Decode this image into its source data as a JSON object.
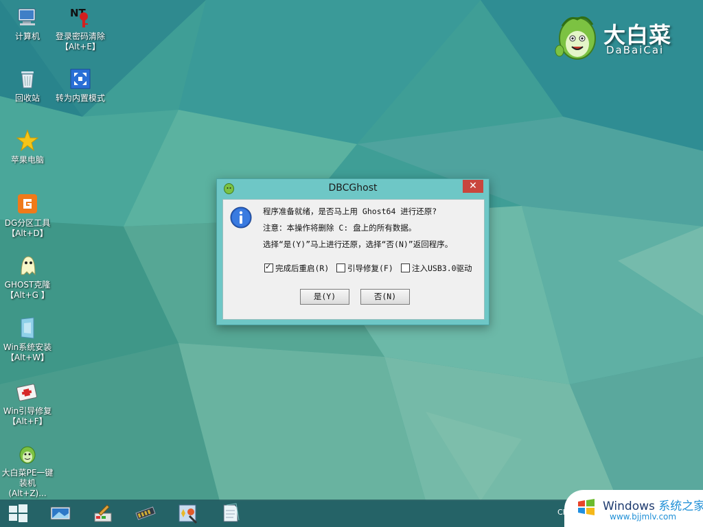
{
  "desktop": {
    "icons": [
      {
        "name": "computer",
        "label": "计算机",
        "icon": "computer-icon"
      },
      {
        "name": "password-clear",
        "label": "登录密码清除\n【Alt+E】",
        "icon": "password-clear-icon"
      },
      {
        "name": "recycle-bin",
        "label": "回收站",
        "icon": "recycle-bin-icon"
      },
      {
        "name": "switch-internal-mode",
        "label": "转为内置模式",
        "icon": "switch-mode-icon"
      },
      {
        "name": "apple-computer",
        "label": "苹果电脑",
        "icon": "star-icon"
      },
      {
        "name": "dg-partition",
        "label": "DG分区工具\n【Alt+D】",
        "icon": "dg-partition-icon"
      },
      {
        "name": "ghost-clone",
        "label": "GHOST克隆\n【Alt+G 】",
        "icon": "ghost-icon"
      },
      {
        "name": "win-install",
        "label": "Win系统安装\n【Alt+W】",
        "icon": "win-install-icon"
      },
      {
        "name": "win-boot-repair",
        "label": "Win引导修复\n【Alt+F】",
        "icon": "first-aid-icon"
      },
      {
        "name": "dabaicai-pe-install",
        "label": "大白菜PE一键\n装机(Alt+Z)...",
        "icon": "dabaicai-icon"
      }
    ]
  },
  "brand": {
    "name_cn": "大白菜",
    "name_en": "DaBaiCai"
  },
  "dialog": {
    "title": "DBCGhost",
    "close_label": "✕",
    "message_line1": "程序准备就绪，是否马上用 Ghost64 进行还原?",
    "message_line2": "注意：本操作将删除 C: 盘上的所有数据。",
    "message_line3": "选择“是(Y)”马上进行还原，选择“否(N)”返回程序。",
    "options": [
      {
        "label": "完成后重启(R)",
        "checked": true
      },
      {
        "label": "引导修复(F)",
        "checked": false
      },
      {
        "label": "注入USB3.0驱动",
        "checked": false
      }
    ],
    "yes_label": "是(Y)",
    "no_label": "否(N)"
  },
  "taskbar": {
    "items": [
      "start-icon",
      "desktop-icon",
      "paint-icon",
      "memory-icon",
      "tools-icon",
      "notepad-icon"
    ],
    "tray_text": "CH"
  },
  "watermark": {
    "line1_main": "Windows ",
    "line1_accent": "系统之家",
    "line2": "www.bjjmlv.com"
  },
  "colors": {
    "dialog_frame": "#6ec7c6",
    "close_button": "#c9463d",
    "taskbar": "#1e525a",
    "watermark_accent": "#1e8fd6"
  }
}
